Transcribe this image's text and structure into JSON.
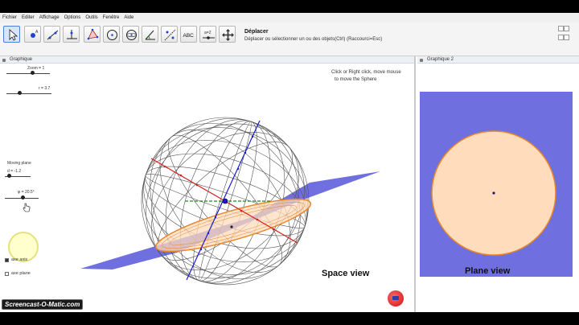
{
  "menu": [
    "Fichier",
    "Editer",
    "Affichage",
    "Options",
    "Outils",
    "Fenêtre",
    "Aide"
  ],
  "toolbar": {
    "tools": [
      "move-tool",
      "point-tool",
      "line-tool",
      "perpendicular-tool",
      "polygon-tool",
      "circle-tool",
      "sphere-tool",
      "angle-tool",
      "reflect-tool",
      "text-tool",
      "slider-tool",
      "move-view-tool"
    ],
    "text_tool_label": "ABC",
    "slider_tool_label": "a=2",
    "active_title": "Déplacer",
    "active_desc": "Déplacer ou sélectionner un ou des objets(Ctrl) (Raccourci=Esc)"
  },
  "left_panel": {
    "title": "Graphique",
    "sliders": {
      "zoom_label": "Zoom = 1",
      "r_label": "r = 3.7",
      "moving_plane_label": "Moving plane",
      "d_label": "d = -1.2",
      "phi_label": "φ = 20.5°"
    },
    "hint_line1": "Click or Right click, move mouse",
    "hint_line2": "to move the Sphere",
    "checkbox_axis": "axe axis",
    "checkbox_plane": "axe plane",
    "view_label": "Space view"
  },
  "right_panel": {
    "title": "Graphique 2",
    "view_label": "Plane view"
  },
  "watermark": "Screencast-O-Matic.com",
  "colors": {
    "plane": "#6f6fe0",
    "disk_fill": "#ffdcbc",
    "disk_edge": "#e8862a",
    "sphere_mesh": "#5a5a5a",
    "red_axis": "#d42020",
    "blue_axis": "#1a1ad0",
    "green_axis": "#1a8a1a"
  }
}
